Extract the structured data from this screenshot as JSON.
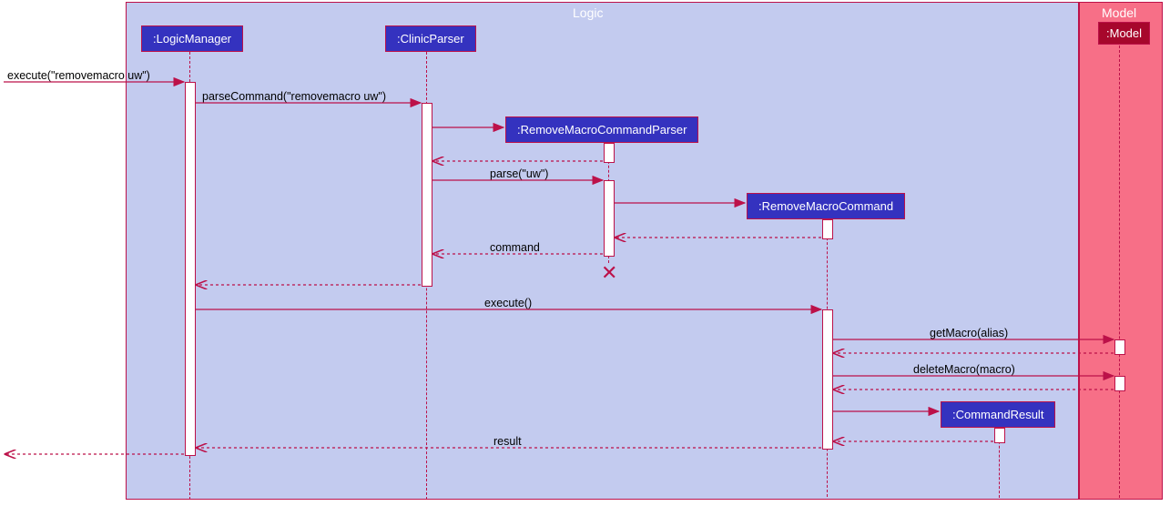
{
  "boxes": {
    "logic": {
      "title": "Logic"
    },
    "model": {
      "title": "Model"
    }
  },
  "participants": {
    "logicManager": ":LogicManager",
    "clinicParser": ":ClinicParser",
    "removeMacroCommandParser": ":RemoveMacroCommandParser",
    "removeMacroCommand": ":RemoveMacroCommand",
    "commandResult": ":CommandResult",
    "model": ":Model"
  },
  "messages": {
    "executeCall": "execute(\"removemacro uw\")",
    "parseCommand": "parseCommand(\"removemacro uw\")",
    "parseUw": "parse(\"uw\")",
    "command": "command",
    "execute": "execute()",
    "getMacro": "getMacro(alias)",
    "deleteMacro": "deleteMacro(macro)",
    "result": "result"
  }
}
